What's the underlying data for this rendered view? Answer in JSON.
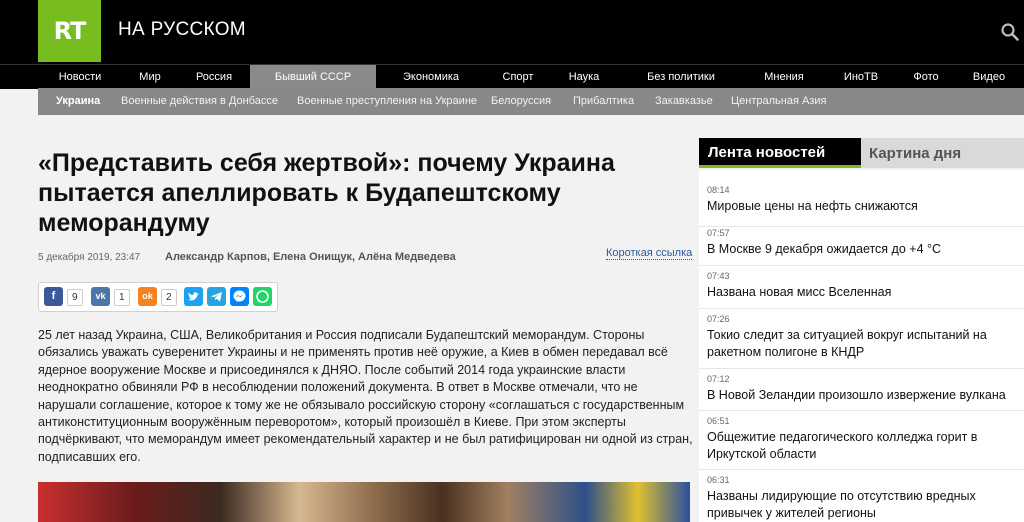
{
  "header": {
    "logo": "RT",
    "site_title": "НА РУССКОМ",
    "search_icon": "search-icon"
  },
  "main_nav": [
    {
      "label": "Новости"
    },
    {
      "label": "Мир"
    },
    {
      "label": "Россия"
    },
    {
      "label": "Бывший СССР",
      "active": true
    },
    {
      "label": "Экономика"
    },
    {
      "label": "Спорт"
    },
    {
      "label": "Наука"
    },
    {
      "label": "Без политики"
    },
    {
      "label": "Мнения"
    },
    {
      "label": "ИноТВ"
    },
    {
      "label": "Фото"
    },
    {
      "label": "Видео"
    }
  ],
  "sub_nav": [
    {
      "label": "Украина",
      "active": true
    },
    {
      "label": "Военные действия в Донбассе"
    },
    {
      "label": "Военные преступления на Украине"
    },
    {
      "label": "Белоруссия"
    },
    {
      "label": "Прибалтика"
    },
    {
      "label": "Закавказье"
    },
    {
      "label": "Центральная Азия"
    }
  ],
  "article": {
    "headline": "«Представить себя жертвой»: почему Украина пытается апеллировать к Будапештскому меморандуму",
    "date": "5 декабря 2019, 23:47",
    "authors": "Александр Карпов, Елена Онищук, Алёна Медведева",
    "short_link": "Короткая ссылка",
    "lead": "25 лет назад Украина, США, Великобритания и Россия подписали Будапештский меморандум. Стороны обязались уважать суверенитет Украины и не применять против неё оружие, а Киев в обмен передавал всё ядерное вооружение Москве и присоединялся к ДНЯО. После событий 2014 года украинские власти неоднократно обвиняли РФ в несоблюдении положений документа. В ответ в Москве отмечали, что не нарушали соглашение, которое к тому же не обязывало российскую сторону «соглашаться с государственным антиконституционным вооружённым переворотом», который произошёл в Киеве. При этом эксперты подчёркивают, что меморандум имеет рекомендательный характер и не был ратифицирован ни одной из стран, подписавших его."
  },
  "share": {
    "facebook": {
      "icon": "facebook-icon",
      "glyph": "f",
      "count": "9",
      "color": "#3b5998"
    },
    "vk": {
      "icon": "vk-icon",
      "glyph": "vk",
      "count": "1",
      "color": "#4a76a8"
    },
    "ok": {
      "icon": "odnoklassniki-icon",
      "glyph": "ok",
      "count": "2",
      "color": "#f58220"
    },
    "twitter": {
      "icon": "twitter-icon",
      "color": "#1da1f2"
    },
    "telegram": {
      "icon": "telegram-icon",
      "color": "#2aa3df"
    },
    "messenger": {
      "icon": "messenger-icon",
      "color": "#0084ff"
    },
    "whatsapp": {
      "icon": "whatsapp-icon",
      "color": "#25d366"
    }
  },
  "sidebar": {
    "tab_active": "Лента новостей",
    "tab_inactive": "Картина дня",
    "news": [
      {
        "time": "08:14",
        "title": "Мировые цены на нефть снижаются"
      },
      {
        "time": "07:57",
        "title": "В Москве 9 декабря ожидается до +4 °C"
      },
      {
        "time": "07:43",
        "title": "Названа новая мисс Вселенная"
      },
      {
        "time": "07:26",
        "title": "Токио следит за ситуацией вокруг испытаний на ракетном полигоне в КНДР"
      },
      {
        "time": "07:12",
        "title": "В Новой Зеландии произошло извержение вулкана"
      },
      {
        "time": "06:51",
        "title": "Общежитие педагогического колледжа горит в Иркутской области"
      },
      {
        "time": "06:31",
        "title": "Названы лидирующие по отсутствию вредных привычек у жителей регионы"
      }
    ]
  },
  "colors": {
    "brand_green": "#77bd1f",
    "nav_active": "#8a8a8a",
    "subnav_bg": "#888888",
    "link_blue": "#2a5a9a"
  }
}
